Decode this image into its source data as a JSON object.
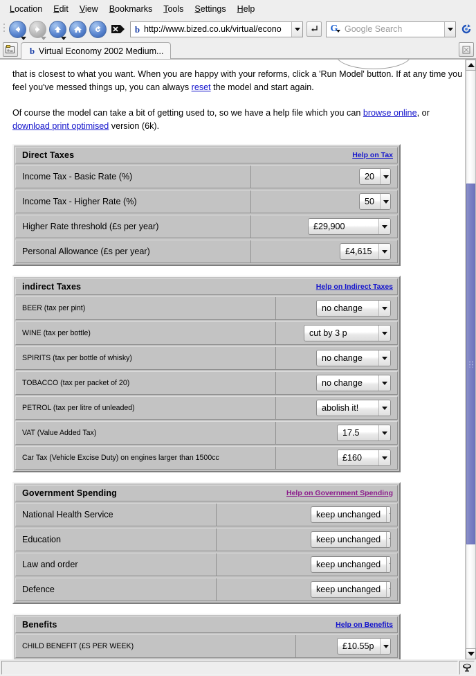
{
  "browser": {
    "menubar": [
      {
        "label": "Location",
        "accel": "L"
      },
      {
        "label": "Edit",
        "accel": "E"
      },
      {
        "label": "View",
        "accel": "V"
      },
      {
        "label": "Bookmarks",
        "accel": "B"
      },
      {
        "label": "Tools",
        "accel": "T"
      },
      {
        "label": "Settings",
        "accel": "S"
      },
      {
        "label": "Help",
        "accel": "H"
      }
    ],
    "toolbar": {
      "back_icon": "back-arrow-icon",
      "forward_icon": "forward-arrow-icon",
      "up_icon": "up-arrow-icon",
      "home_icon": "home-icon",
      "reload_icon": "reload-icon",
      "stop_icon": "stop-icon",
      "go_icon": "go-enter-icon",
      "refresh_icon": "refresh-icon"
    },
    "url": {
      "value": "http://www.bized.co.uk/virtual/econo",
      "favicon": "bized-b-icon"
    },
    "search": {
      "placeholder": "Google Search",
      "engine_icon": "google-g-icon"
    },
    "tab": {
      "title": "Virtual Economy 2002 Medium...",
      "favicon": "bized-b-icon",
      "new_tab_icon": "new-tab-icon",
      "tab_list_icon": "tab-list-icon"
    },
    "statusbar": {
      "text": "",
      "icon": "page-security-icon"
    },
    "scrollbar": {
      "up_icon": "scroll-up-arrow-icon",
      "down_icon": "scroll-down-arrow-icon"
    }
  },
  "page": {
    "intro": {
      "para1_a": "that is closest to what you want. When you are happy with your reforms, click a 'Run Model' button. If at any time you feel you've messed things up, you can always ",
      "para1_link": "reset",
      "para1_b": " the model and start again.",
      "para2_a": "Of course the model can take a bit of getting used to, so we have a help file which you can ",
      "para2_link1": "browse online",
      "para2_b": ", or ",
      "para2_link2": "download print optimised",
      "para2_c": " version (6k)."
    },
    "sections": [
      {
        "title": "Direct Taxes",
        "help_label": "Help on Tax",
        "help_visited": false,
        "label_col_width": 340,
        "rows": [
          {
            "label": "Income Tax - Basic Rate (%)",
            "value": "20",
            "select_width": 46
          },
          {
            "label": "Income Tax - Higher Rate (%)",
            "value": "50",
            "select_width": 46
          },
          {
            "label": "Higher Rate threshold (£s per year)",
            "value": "£29,900",
            "select_width": 120
          },
          {
            "label": "Personal Allowance (£s per year)",
            "value": "£4,615",
            "select_width": 74
          }
        ]
      },
      {
        "title": "indirect Taxes",
        "help_label": "Help on Indirect Taxes",
        "help_visited": false,
        "label_col_width": 376,
        "small_labels": true,
        "rows": [
          {
            "label": "BEER (tax per pint)",
            "value": "no change",
            "select_width": 108
          },
          {
            "label": "WINE (tax per bottle)",
            "value": "cut by 3 p",
            "select_width": 126
          },
          {
            "label": "SPIRITS (tax per bottle of whisky)",
            "value": "no change",
            "select_width": 108
          },
          {
            "label": "TOBACCO (tax per packet of 20)",
            "value": "no change",
            "select_width": 108
          },
          {
            "label": "PETROL (tax per litre of unleaded)",
            "value": "abolish it!",
            "select_width": 108
          },
          {
            "label": "VAT (Value Added Tax)",
            "value": "17.5",
            "select_width": 78
          },
          {
            "label": "Car Tax (Vehicle Excise Duty) on engines larger than 1500cc",
            "value": "£160",
            "select_width": 78
          }
        ]
      },
      {
        "title": "Government Spending",
        "help_label": "Help on Government Spending",
        "help_visited": true,
        "label_col_width": 290,
        "rows": [
          {
            "label": "National Health Service",
            "value": "keep unchanged",
            "select_width": 116
          },
          {
            "label": "Education",
            "value": "keep unchanged",
            "select_width": 116
          },
          {
            "label": "Law and order",
            "value": "keep unchanged",
            "select_width": 116
          },
          {
            "label": "Defence",
            "value": "keep unchanged",
            "select_width": 116
          }
        ]
      },
      {
        "title": "Benefits",
        "help_label": "Help on Benefits",
        "help_visited": false,
        "label_col_width": 405,
        "small_labels": true,
        "rows": [
          {
            "label": "CHILD BENEFIT (£S PER WEEK)",
            "value": "£10.55p",
            "select_width": 78
          }
        ]
      }
    ]
  }
}
